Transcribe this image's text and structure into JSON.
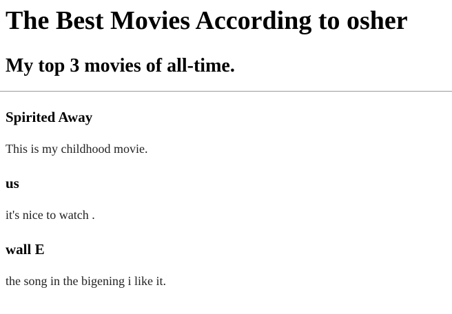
{
  "header": {
    "title": "The Best Movies According to osher",
    "subtitle": "My top 3 movies of all-time."
  },
  "movies": [
    {
      "title": "Spirited Away",
      "description": "This is my childhood movie."
    },
    {
      "title": "us",
      "description": "it's nice to watch ."
    },
    {
      "title": "wall E",
      "description": "the song in the bigening i like it."
    }
  ]
}
